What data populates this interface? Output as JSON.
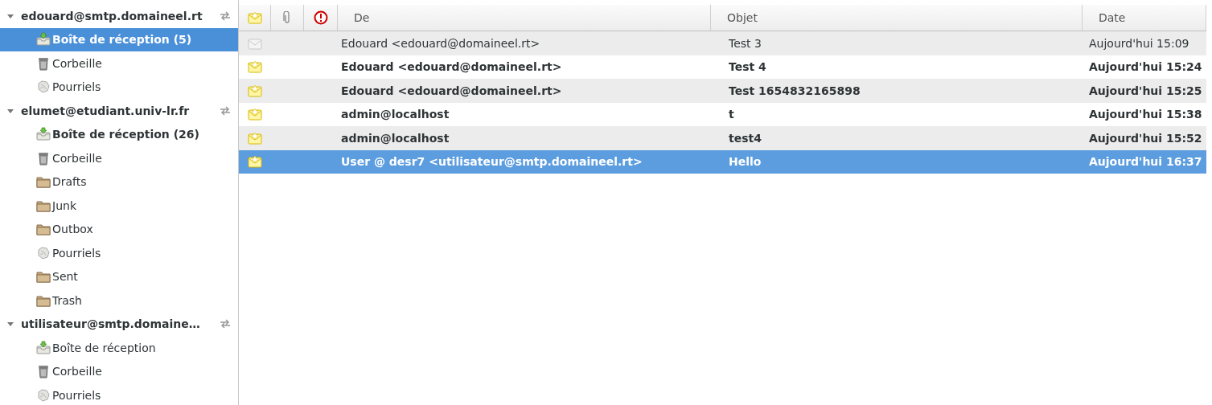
{
  "accounts": [
    {
      "name": "edouard@smtp.domaineel.rt",
      "expanded": true,
      "folders": [
        {
          "kind": "inbox",
          "label": "Boîte de réception (5)",
          "selected": true,
          "unread": true
        },
        {
          "kind": "trash",
          "label": "Corbeille",
          "selected": false,
          "unread": false
        },
        {
          "kind": "junk",
          "label": "Pourriels",
          "selected": false,
          "unread": false
        }
      ]
    },
    {
      "name": "elumet@etudiant.univ-lr.fr",
      "expanded": true,
      "folders": [
        {
          "kind": "inbox",
          "label": "Boîte de réception (26)",
          "selected": false,
          "unread": true
        },
        {
          "kind": "trash",
          "label": "Corbeille",
          "selected": false,
          "unread": false
        },
        {
          "kind": "folder",
          "label": "Drafts",
          "selected": false,
          "unread": false
        },
        {
          "kind": "folder",
          "label": "Junk",
          "selected": false,
          "unread": false
        },
        {
          "kind": "folder",
          "label": "Outbox",
          "selected": false,
          "unread": false
        },
        {
          "kind": "junk",
          "label": "Pourriels",
          "selected": false,
          "unread": false
        },
        {
          "kind": "folder",
          "label": "Sent",
          "selected": false,
          "unread": false
        },
        {
          "kind": "folder",
          "label": "Trash",
          "selected": false,
          "unread": false
        }
      ]
    },
    {
      "name": "utilisateur@smtp.domaine…",
      "expanded": true,
      "folders": [
        {
          "kind": "inbox",
          "label": "Boîte de réception",
          "selected": false,
          "unread": false
        },
        {
          "kind": "trash",
          "label": "Corbeille",
          "selected": false,
          "unread": false
        },
        {
          "kind": "junk",
          "label": "Pourriels",
          "selected": false,
          "unread": false
        }
      ]
    }
  ],
  "message_list": {
    "columns": [
      "De",
      "Objet",
      "Date"
    ],
    "messages": [
      {
        "from": "Edouard <edouard@domaineel.rt>",
        "subject": "Test 3",
        "date": "Aujourd'hui 15:09",
        "unread": false,
        "selected": false
      },
      {
        "from": "Edouard <edouard@domaineel.rt>",
        "subject": "Test 4",
        "date": "Aujourd'hui 15:24",
        "unread": true,
        "selected": false
      },
      {
        "from": "Edouard <edouard@domaineel.rt>",
        "subject": "Test 1654832165898",
        "date": "Aujourd'hui 15:25",
        "unread": true,
        "selected": false
      },
      {
        "from": "admin@localhost",
        "subject": "t",
        "date": "Aujourd'hui 15:38",
        "unread": true,
        "selected": false
      },
      {
        "from": "admin@localhost",
        "subject": "test4",
        "date": "Aujourd'hui 15:52",
        "unread": true,
        "selected": false
      },
      {
        "from": "User @ desr7 <utilisateur@smtp.domaineel.rt>",
        "subject": "Hello",
        "date": "Aujourd'hui 16:37",
        "unread": true,
        "selected": true
      }
    ]
  }
}
